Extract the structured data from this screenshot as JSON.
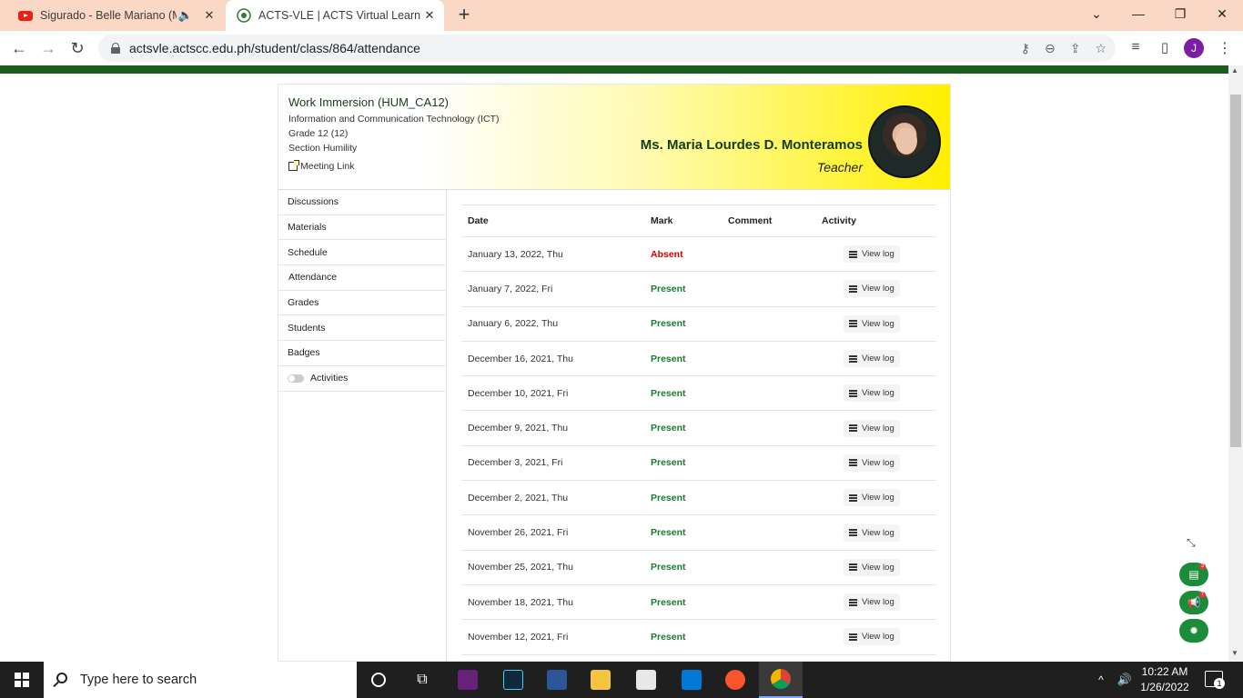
{
  "browser": {
    "tabs": [
      {
        "title": "Sigurado - Belle Mariano (M",
        "icon": "youtube-icon",
        "audio": "speaker-icon"
      },
      {
        "title": "ACTS-VLE | ACTS Virtual Learning",
        "icon": "acts-logo-icon"
      }
    ],
    "new_tab": "+",
    "url": "actsvle.actscc.edu.ph/student/class/864/attendance",
    "profile_initial": "J"
  },
  "course": {
    "name": "Work Immersion (HUM_CA12)",
    "program": "Information and Communication Technology (ICT)",
    "grade": "Grade 12 (12)",
    "section": "Section Humility",
    "meeting_link": "Meeting Link",
    "teacher": "Ms. Maria Lourdes D. Monteramos",
    "role": "Teacher"
  },
  "sidebar": {
    "items": [
      {
        "label": "Discussions"
      },
      {
        "label": "Materials"
      },
      {
        "label": "Schedule"
      },
      {
        "label": "Attendance"
      },
      {
        "label": "Grades"
      },
      {
        "label": "Students"
      },
      {
        "label": "Badges"
      },
      {
        "label": "Activities"
      }
    ]
  },
  "table": {
    "headers": {
      "date": "Date",
      "mark": "Mark",
      "comment": "Comment",
      "activity": "Activity"
    },
    "view_log": "View log",
    "rows": [
      {
        "date": "January 13, 2022, Thu",
        "mark": "Absent"
      },
      {
        "date": "January 7, 2022, Fri",
        "mark": "Present"
      },
      {
        "date": "January 6, 2022, Thu",
        "mark": "Present"
      },
      {
        "date": "December 16, 2021, Thu",
        "mark": "Present"
      },
      {
        "date": "December 10, 2021, Fri",
        "mark": "Present"
      },
      {
        "date": "December 9, 2021, Thu",
        "mark": "Present"
      },
      {
        "date": "December 3, 2021, Fri",
        "mark": "Present"
      },
      {
        "date": "December 2, 2021, Thu",
        "mark": "Present"
      },
      {
        "date": "November 26, 2021, Fri",
        "mark": "Present"
      },
      {
        "date": "November 25, 2021, Thu",
        "mark": "Present"
      },
      {
        "date": "November 18, 2021, Thu",
        "mark": "Present"
      },
      {
        "date": "November 12, 2021, Fri",
        "mark": "Present"
      }
    ]
  },
  "floating": {
    "calendar_badge": "3",
    "announce_badge": "7"
  },
  "taskbar": {
    "search_placeholder": "Type here to search",
    "time": "10:22 AM",
    "date": "1/26/2022",
    "notification_count": "1"
  },
  "colors": {
    "brand_green": "#1b5e20",
    "absent": "#d50000",
    "present": "#1b7a2e",
    "header_yellow": "#ffef00"
  }
}
